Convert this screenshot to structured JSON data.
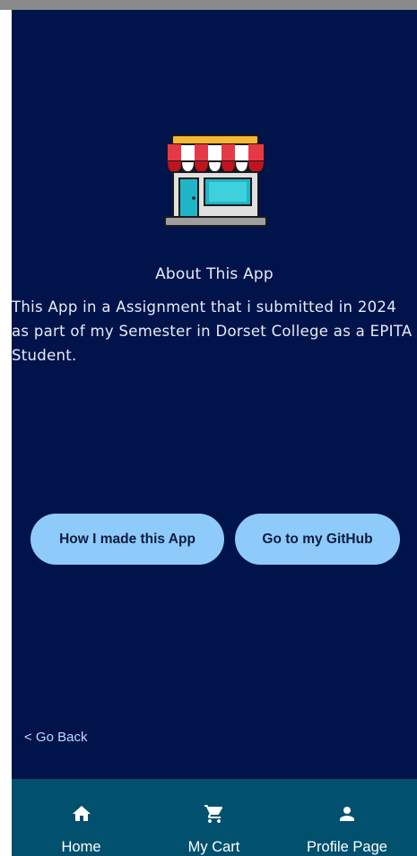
{
  "about": {
    "title": "About This App",
    "body": "This App in a Assignment that i submitted in 2024 as part of my Semester in Dorset College as a EPITA Student."
  },
  "buttons": {
    "how_made": "How I made this App",
    "github": "Go to my GitHub"
  },
  "go_back": "< Go Back",
  "nav": {
    "home": {
      "label": "Home",
      "icon": "home-icon"
    },
    "cart": {
      "label": "My Cart",
      "icon": "cart-icon"
    },
    "profile": {
      "label": "Profile Page",
      "icon": "person-icon"
    }
  },
  "colors": {
    "background": "#00134a",
    "button": "#8ecbfb",
    "nav_bar": "#00506e",
    "link": "#b9dcff"
  }
}
